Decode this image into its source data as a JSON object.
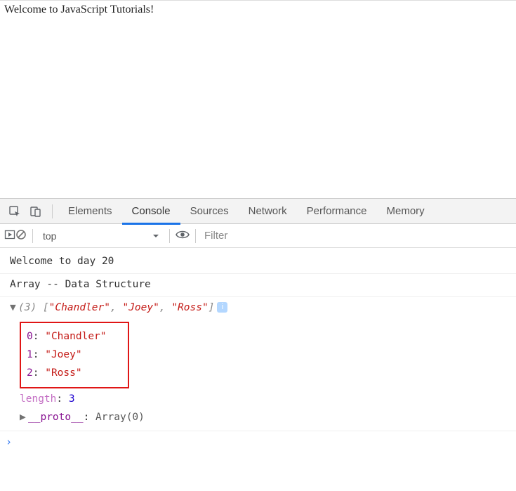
{
  "page": {
    "heading": "Welcome to JavaScript Tutorials!"
  },
  "tabs": {
    "elements": "Elements",
    "console": "Console",
    "sources": "Sources",
    "network": "Network",
    "performance": "Performance",
    "memory": "Memory"
  },
  "filterbar": {
    "context": "top",
    "filter_placeholder": "Filter"
  },
  "console": {
    "line1": "Welcome to day 20",
    "line2": "Array -- Data Structure",
    "array": {
      "length": 3,
      "items": [
        "Chandler",
        "Joey",
        "Ross"
      ],
      "length_label": "length",
      "length_value": "3",
      "proto_label": "__proto__",
      "proto_value": "Array(0)"
    }
  },
  "icons": {
    "inspect": "inspect",
    "device": "device",
    "run": "run",
    "clear": "clear",
    "eye": "eye",
    "info": "i"
  }
}
